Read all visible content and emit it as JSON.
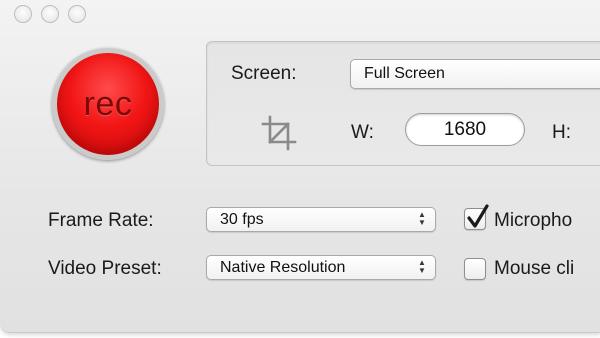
{
  "recorder": {
    "rec_label": "rec"
  },
  "capture": {
    "screen_label": "Screen:",
    "screen_value": "Full Screen",
    "width_label": "W:",
    "width_value": "1680",
    "height_label": "H:"
  },
  "settings": {
    "frame_rate_label": "Frame Rate:",
    "frame_rate_value": "30 fps",
    "video_preset_label": "Video Preset:",
    "video_preset_value": "Native Resolution"
  },
  "options": {
    "microphone_label": "Micropho",
    "microphone_checked": true,
    "mouse_clicks_label": "Mouse cli",
    "mouse_clicks_checked": false
  },
  "icons": [
    "close-icon",
    "minimize-icon",
    "zoom-icon",
    "crop-icon",
    "popup-arrows-icon",
    "checkmark-icon"
  ],
  "colors": {
    "record_red": "#f21616",
    "window_gray": "#e6e6e6"
  }
}
